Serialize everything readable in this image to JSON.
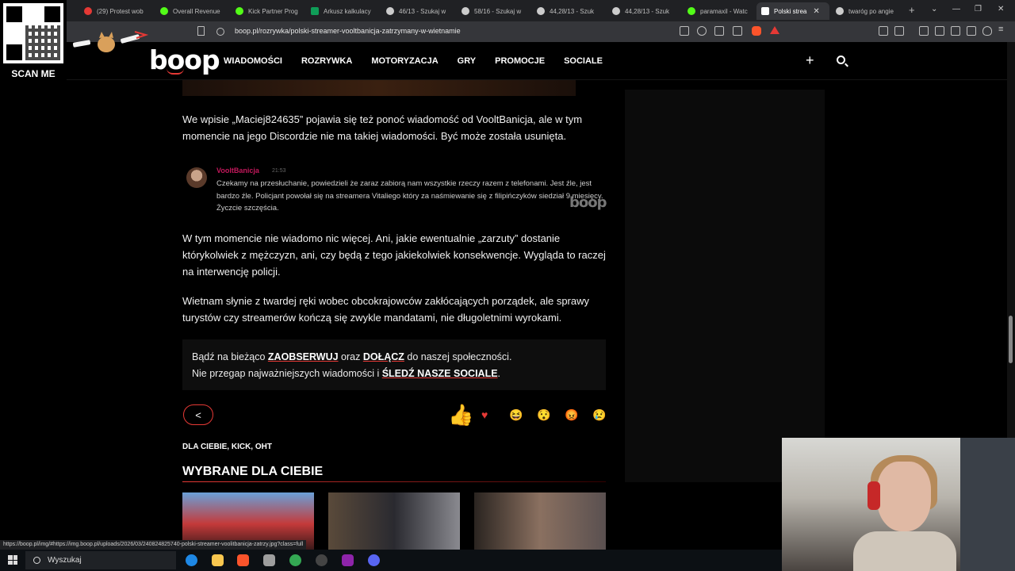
{
  "browser": {
    "tabs": [
      {
        "label": "(29) Protest wob",
        "color": "#e53935"
      },
      {
        "label": "Overall Revenue",
        "color": "#53fc18"
      },
      {
        "label": "Kick Partner Prog",
        "color": "#53fc18"
      },
      {
        "label": "Arkusz kalkulacy",
        "color": "#0f9d58"
      },
      {
        "label": "46/13 - Szukaj w",
        "color": "#cccccc"
      },
      {
        "label": "58/16 - Szukaj w",
        "color": "#cccccc"
      },
      {
        "label": "44,28/13 - Szuk",
        "color": "#cccccc"
      },
      {
        "label": "44,28/13 - Szuk",
        "color": "#cccccc"
      },
      {
        "label": "paramaxil - Watc",
        "color": "#53fc18"
      },
      {
        "label": "Polski strea",
        "color": "#ffffff"
      },
      {
        "label": "twaróg po angie",
        "color": "#cccccc"
      }
    ],
    "new_tab_glyph": "+",
    "window_controls": [
      "⌄",
      "—",
      "❐",
      "✕"
    ],
    "url": "boop.pl/rozrywka/polski-streamer-vooltbanicja-zatrzymany-w-wietnamie",
    "status_url": "https://boop.pl/img/#https://img.boop.pl/uploads/2026/03/240824825740-polski-streamer-voolitbanicja-zatrzy.jpg?class=full"
  },
  "site": {
    "logo": "boop",
    "nav": [
      "WIADOMOŚCI",
      "ROZRYWKA",
      "MOTORYZACJA",
      "GRY",
      "PROMOCJE",
      "SOCIALE"
    ],
    "plus_glyph": "+"
  },
  "article": {
    "p1": "We wpisie „Maciej824635” pojawia się też ponoć wiadomość od VooltBanicja, ale w tym momencie na jego Discordzie nie ma takiej wiadomości. Być może została usunięta.",
    "discord": {
      "username": "VooltBanicja",
      "time": "21:53",
      "message": "Czekamy na przesłuchanie, powiedzieli że zaraz zabiorą nam wszystkie rzeczy razem z telefonami. Jest źle, jest bardzo źle. Policjant powołał się na streamera Vitaliego który za naśmiewanie się z filipińczyków siedział 9 miesięcy. Życzcie szczęścia.",
      "watermark": "boop"
    },
    "p2": "W tym momencie nie wiadomo nic więcej. Ani, jakie ewentualnie „zarzuty” dostanie którykolwiek z mężczyzn, ani, czy będą z tego jakiekolwiek konsekwencje. Wygląda to raczej na interwencję policji.",
    "p3": "Wietnam słynie z twardej ręki wobec obcokrajowców zakłócających porządek, ale sprawy turystów czy streamerów kończą się zwykle mandatami, nie długoletnimi wyrokami.",
    "cta": {
      "l1_a": "Bądź na bieżąco ",
      "l1_b": "ZAOBSERWUJ",
      "l1_c": " oraz ",
      "l1_d": "DOŁĄCZ",
      "l1_e": " do naszej społeczności.",
      "l2_a": "Nie przegap najważniejszych wiadomości i ",
      "l2_b": "ŚLEDŹ NASZE SOCIALE",
      "l2_c": "."
    },
    "share_glyph": "<",
    "reactions": [
      "👍",
      "♥",
      "😆",
      "😯",
      "😡",
      "😢"
    ],
    "tags": "DLA CIEBIE, KICK, OHT",
    "section_title": "WYBRANE DLA CIEBIE"
  },
  "overlay": {
    "qr_label": "SCAN ME"
  },
  "taskbar": {
    "search_label": "Wyszukaj"
  },
  "colors": {
    "accent": "#e53935",
    "background": "#000000",
    "text": "#f0f0f0"
  }
}
